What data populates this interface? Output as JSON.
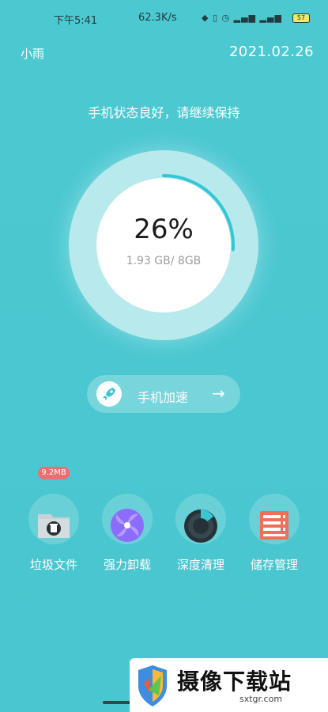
{
  "status_bar": {
    "time": "下午5:41",
    "network_speed": "62.3K/s",
    "icons": [
      "bluetooth-icon",
      "vibrate-icon",
      "alarm-icon",
      "signal-icon",
      "battery-icon"
    ],
    "battery": "57"
  },
  "header": {
    "user_name": "小雨",
    "date": "2021.02.26"
  },
  "status_message": "手机状态良好，请继续保持",
  "memory_gauge": {
    "percent_label": "26%",
    "usage_label": "1.93 GB/ 8GB",
    "progress": 0.26
  },
  "boost_button": {
    "label": "手机加速",
    "icon": "rocket-icon",
    "arrow": "→"
  },
  "junk_badge": "9.2MB",
  "tools": [
    {
      "id": "junk-files",
      "label": "垃圾文件",
      "icon": "folder-trash-icon"
    },
    {
      "id": "force-uninstall",
      "label": "强力卸载",
      "icon": "pinwheel-icon"
    },
    {
      "id": "deep-clean",
      "label": "深度清理",
      "icon": "pie-chart-icon"
    },
    {
      "id": "storage-manage",
      "label": "储存管理",
      "icon": "storage-server-icon"
    }
  ],
  "watermark": {
    "brand": "摄像下载站",
    "url": "sxtgr.com"
  },
  "colors": {
    "background": "#4cc8d1",
    "progress_accent": "#33c7d6",
    "badge": "#ee6d70",
    "folder": "#c9d1d6",
    "pinwheel": "#8c6bff",
    "storage": "#ee7058"
  }
}
